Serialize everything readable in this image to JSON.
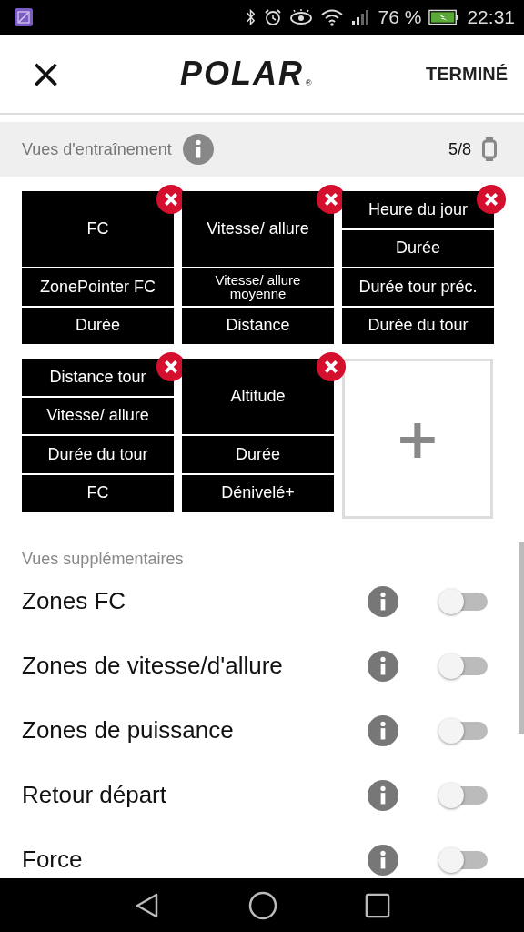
{
  "status_bar": {
    "battery": "76 %",
    "time": "22:31"
  },
  "header": {
    "close": "×",
    "logo": "POLAR",
    "registered": "®",
    "done": "TERMINÉ"
  },
  "training_views": {
    "title": "Vues d'entraînement",
    "count": "5/8",
    "views": [
      {
        "fields": [
          "FC",
          "ZonePointer FC",
          "Durée"
        ]
      },
      {
        "fields": [
          "Vitesse/ allure",
          "Vitesse/ allure moyenne",
          "Distance"
        ]
      },
      {
        "fields": [
          "Heure du jour",
          "Durée",
          "Durée tour préc.",
          "Durée du tour"
        ]
      },
      {
        "fields": [
          "Distance tour",
          "Vitesse/ allure",
          "Durée du tour",
          "FC"
        ]
      },
      {
        "fields": [
          "Altitude",
          "Durée",
          "Dénivelé+"
        ]
      }
    ],
    "add": "+"
  },
  "extra_views": {
    "title": "Vues supplémentaires",
    "items": [
      {
        "label": "Zones FC",
        "on": false
      },
      {
        "label": "Zones de vitesse/d'allure",
        "on": false
      },
      {
        "label": "Zones de puissance",
        "on": false
      },
      {
        "label": "Retour départ",
        "on": false
      },
      {
        "label": "Force",
        "on": false
      }
    ]
  }
}
